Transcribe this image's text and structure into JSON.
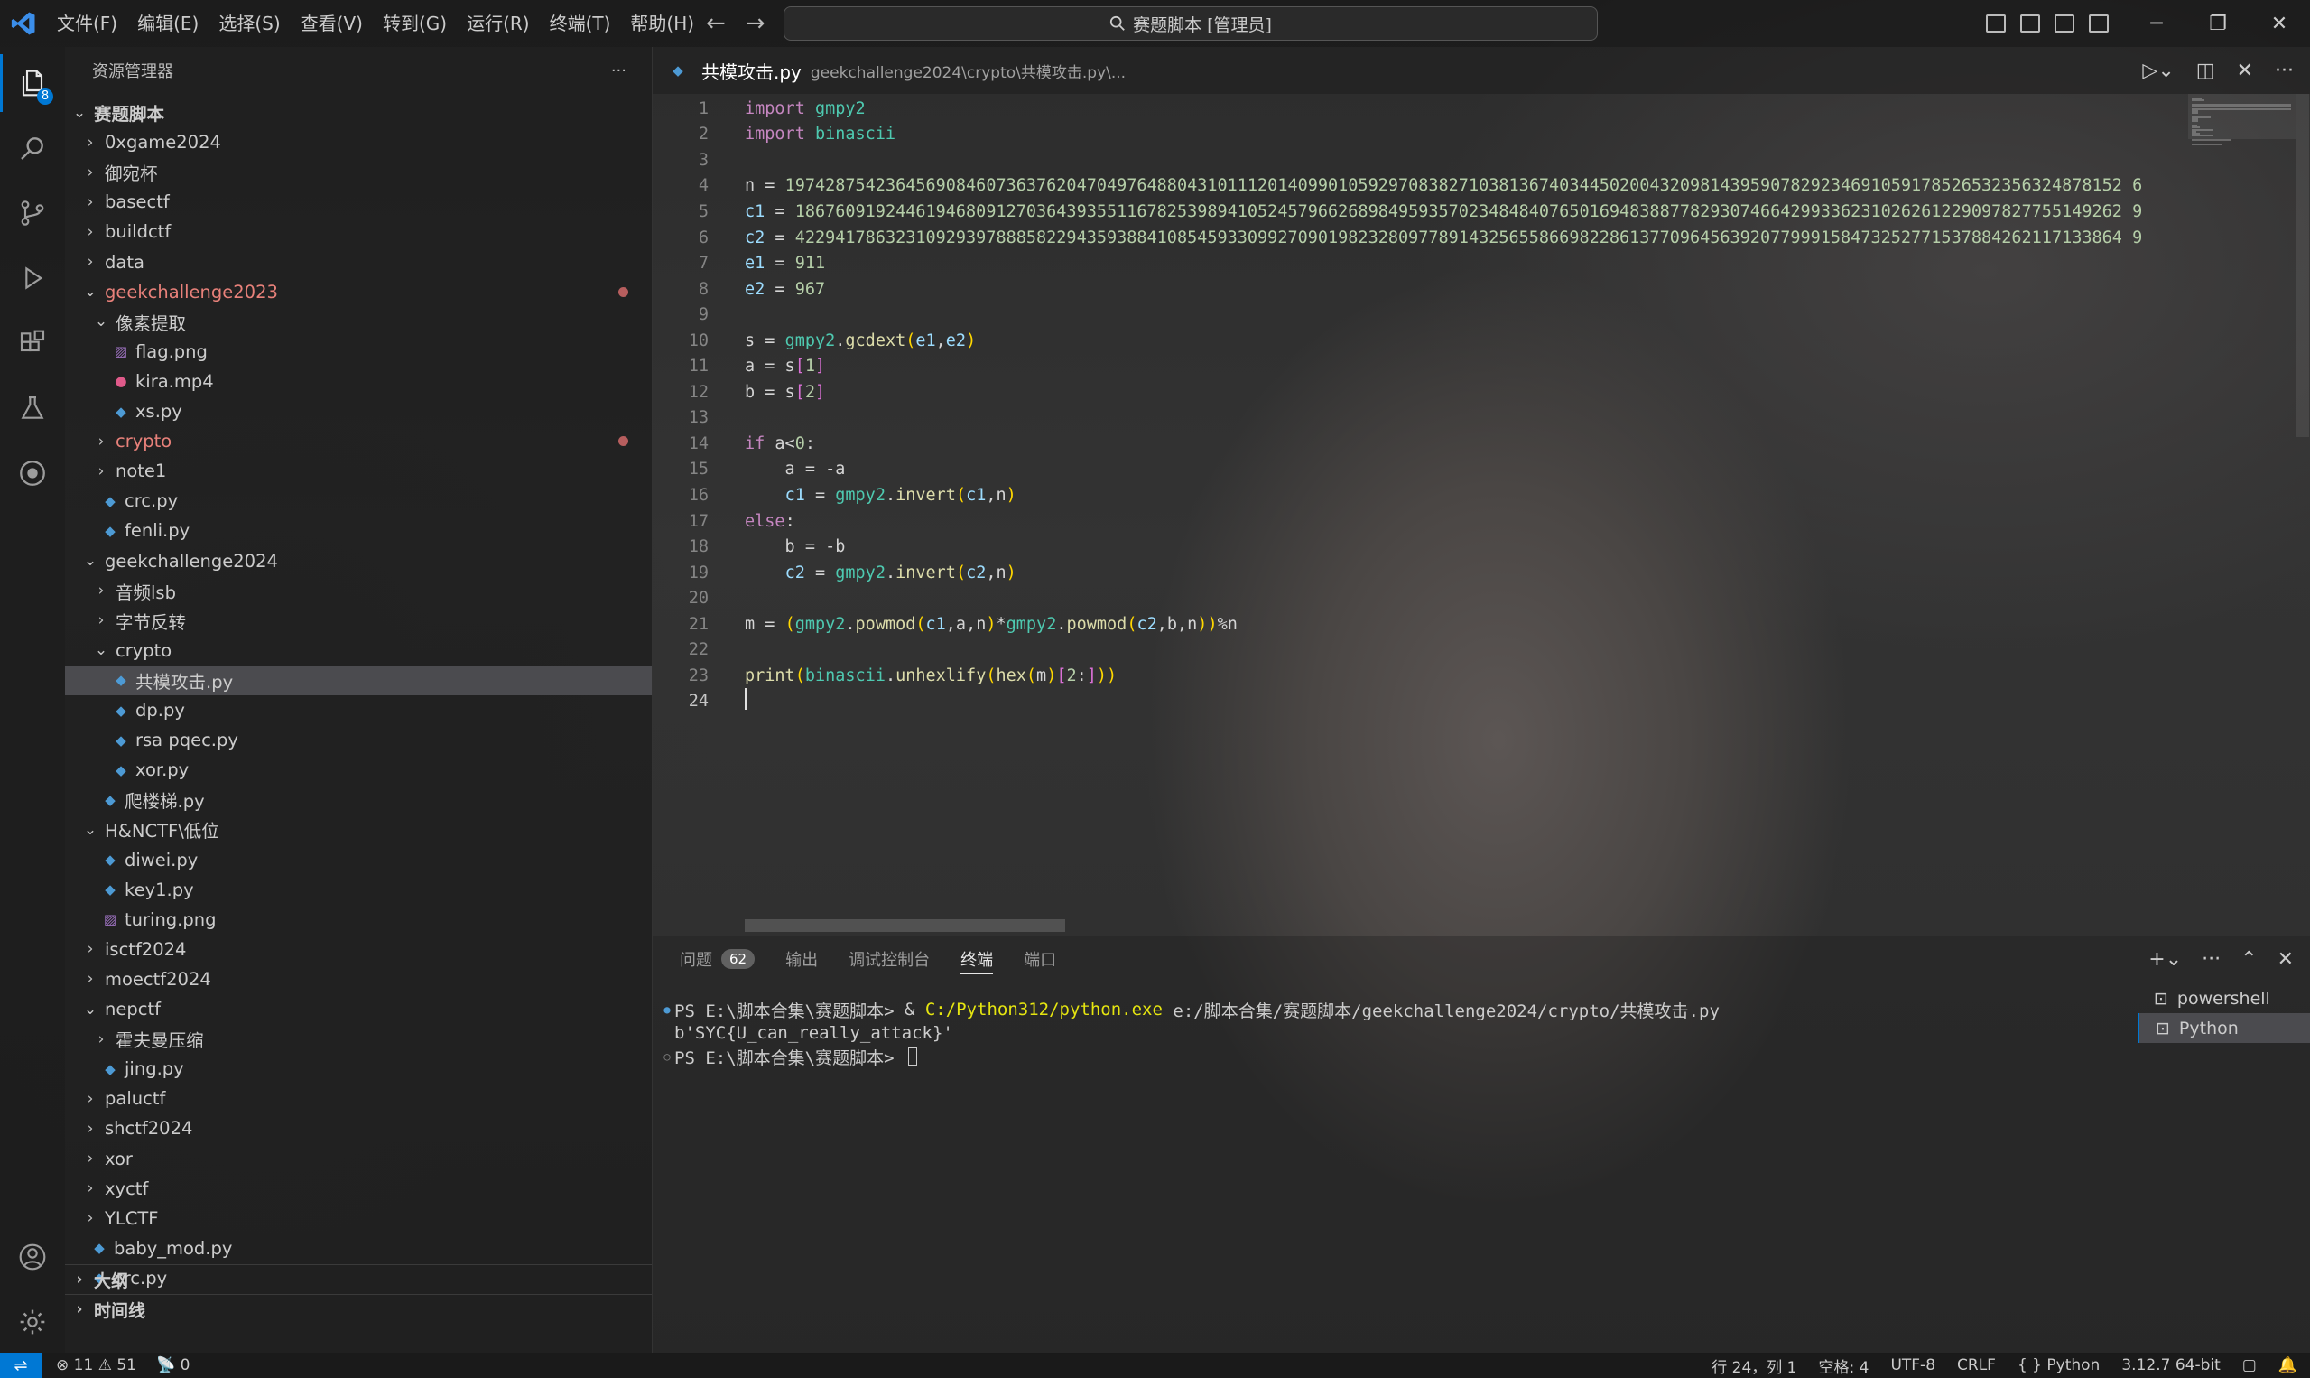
{
  "titlebar": {
    "menus": [
      "文件(F)",
      "编辑(E)",
      "选择(S)",
      "查看(V)",
      "转到(G)",
      "运行(R)",
      "终端(T)",
      "帮助(H)"
    ],
    "search": "赛题脚本 [管理员]"
  },
  "activitybar": {
    "explorer_badge": "8"
  },
  "sidebar": {
    "title": "资源管理器",
    "rows": [
      {
        "label": "赛题脚本",
        "depth": 0,
        "kind": "folder-open",
        "bold": true
      },
      {
        "label": "0xgame2024",
        "depth": 1,
        "kind": "folder"
      },
      {
        "label": "御宛杯",
        "depth": 1,
        "kind": "folder"
      },
      {
        "label": "basectf",
        "depth": 1,
        "kind": "folder"
      },
      {
        "label": "buildctf",
        "depth": 1,
        "kind": "folder"
      },
      {
        "label": "data",
        "depth": 1,
        "kind": "folder"
      },
      {
        "label": "geekchallenge2023",
        "depth": 1,
        "kind": "folder-open",
        "modified": true
      },
      {
        "label": "像素提取",
        "depth": 2,
        "kind": "folder-open"
      },
      {
        "label": "flag.png",
        "depth": 3,
        "kind": "png"
      },
      {
        "label": "kira.mp4",
        "depth": 3,
        "kind": "mp4"
      },
      {
        "label": "xs.py",
        "depth": 3,
        "kind": "py"
      },
      {
        "label": "crypto",
        "depth": 2,
        "kind": "folder",
        "modified": true
      },
      {
        "label": "note1",
        "depth": 2,
        "kind": "folder"
      },
      {
        "label": "crc.py",
        "depth": 2,
        "kind": "py"
      },
      {
        "label": "fenli.py",
        "depth": 2,
        "kind": "py"
      },
      {
        "label": "geekchallenge2024",
        "depth": 1,
        "kind": "folder-open"
      },
      {
        "label": "音频lsb",
        "depth": 2,
        "kind": "folder"
      },
      {
        "label": "字节反转",
        "depth": 2,
        "kind": "folder"
      },
      {
        "label": "crypto",
        "depth": 2,
        "kind": "folder-open"
      },
      {
        "label": "共模攻击.py",
        "depth": 3,
        "kind": "py",
        "selected": true
      },
      {
        "label": "dp.py",
        "depth": 3,
        "kind": "py"
      },
      {
        "label": "rsa pqec.py",
        "depth": 3,
        "kind": "py"
      },
      {
        "label": "xor.py",
        "depth": 3,
        "kind": "py"
      },
      {
        "label": "爬楼梯.py",
        "depth": 2,
        "kind": "py"
      },
      {
        "label": "H&NCTF\\低位",
        "depth": 1,
        "kind": "folder-open"
      },
      {
        "label": "diwei.py",
        "depth": 2,
        "kind": "py"
      },
      {
        "label": "key1.py",
        "depth": 2,
        "kind": "py"
      },
      {
        "label": "turing.png",
        "depth": 2,
        "kind": "png"
      },
      {
        "label": "isctf2024",
        "depth": 1,
        "kind": "folder"
      },
      {
        "label": "moectf2024",
        "depth": 1,
        "kind": "folder"
      },
      {
        "label": "nepctf",
        "depth": 1,
        "kind": "folder-open"
      },
      {
        "label": "霍夫曼压缩",
        "depth": 2,
        "kind": "folder"
      },
      {
        "label": "jing.py",
        "depth": 2,
        "kind": "py"
      },
      {
        "label": "paluctf",
        "depth": 1,
        "kind": "folder"
      },
      {
        "label": "shctf2024",
        "depth": 1,
        "kind": "folder"
      },
      {
        "label": "xor",
        "depth": 1,
        "kind": "folder"
      },
      {
        "label": "xyctf",
        "depth": 1,
        "kind": "folder"
      },
      {
        "label": "YLCTF",
        "depth": 1,
        "kind": "folder"
      },
      {
        "label": "baby_mod.py",
        "depth": 1,
        "kind": "py"
      },
      {
        "label": "crc.py",
        "depth": 1,
        "kind": "py"
      }
    ],
    "sections": [
      "大纲",
      "时间线"
    ]
  },
  "editor": {
    "tab_title": "共模攻击.py",
    "tab_path": "geekchallenge2024\\crypto\\共模攻击.py\\...",
    "current_line": 24,
    "lines": [
      "import gmpy2",
      "import binascii",
      "",
      "n = 1974287542364569084607363762047049764880431011120140990105929708382710381367403445020043209814395907829234691059178526532356324878152 6",
      "c1 = 186760919244619468091270364393551167825398941052457966268984959357023484840765016948388778293074664299336231026261229097827755149262 9",
      "c2 = 422941786323109293978885822943593884108545933099270901982328097789143256558669822861377096456392077999158473252771537884262117133864 9",
      "e1 = 911",
      "e2 = 967",
      "",
      "s = gmpy2.gcdext(e1,e2)",
      "a = s[1]",
      "b = s[2]",
      "",
      "if a<0:",
      "    a = -a",
      "    c1 = gmpy2.invert(c1,n)",
      "else:",
      "    b = -b",
      "    c2 = gmpy2.invert(c2,n)",
      "",
      "m = (gmpy2.powmod(c1,a,n)*gmpy2.powmod(c2,b,n))%n",
      "",
      "print(binascii.unhexlify(hex(m)[2:]))",
      ""
    ]
  },
  "panel": {
    "tabs": [
      "问题",
      "输出",
      "调试控制台",
      "终端",
      "端口"
    ],
    "problems_count": "62",
    "active_tab": "终端",
    "terminal": {
      "line1_prompt": "PS E:\\脚本合集\\赛题脚本> ",
      "line1_amp": "& ",
      "line1_exe": "C:/Python312/python.exe",
      "line1_args": " e:/脚本合集/赛题脚本/geekchallenge2024/crypto/共模攻击.py",
      "line2": "b'SYC{U_can_really_attack}'",
      "line3_prompt": "PS E:\\脚本合集\\赛题脚本> "
    },
    "terminal_list": [
      "powershell",
      "Python"
    ]
  },
  "statusbar": {
    "errors": "11",
    "warnings": "51",
    "ports": "0",
    "position": "行 24，列 1",
    "spaces": "空格: 4",
    "encoding": "UTF-8",
    "eol": "CRLF",
    "language": "Python",
    "interpreter": "3.12.7 64-bit"
  },
  "colors": {
    "accent": "#0078d4",
    "modified": "#e8817a"
  }
}
